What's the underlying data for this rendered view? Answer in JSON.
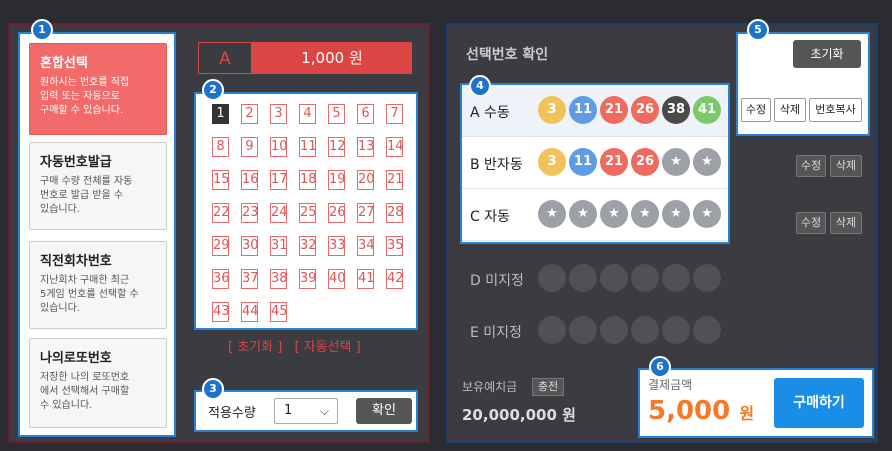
{
  "badges": [
    "1",
    "2",
    "3",
    "4",
    "5",
    "6"
  ],
  "methods": [
    {
      "title": "혼합선택",
      "desc": "원하시는 번호를 직접\n입력 또는 자동으로\n구매할 수 있습니다."
    },
    {
      "title": "자동번호발급",
      "desc": "구매 수량 전체를 자동\n번호로 발급 받을 수\n있습니다."
    },
    {
      "title": "직전회차번호",
      "desc": "지난회차 구매한 최근\n5게임 번호를 선택할 수\n있습니다."
    },
    {
      "title": "나의로또번호",
      "desc": "저장한 나의 로또번호\n에서 선택해서 구매할\n수 있습니다."
    }
  ],
  "slip": {
    "label": "A",
    "price": "1,000 원"
  },
  "grid": {
    "numbers": [
      1,
      2,
      3,
      4,
      5,
      6,
      7,
      8,
      9,
      10,
      11,
      12,
      13,
      14,
      15,
      16,
      17,
      18,
      19,
      20,
      21,
      22,
      23,
      24,
      25,
      26,
      27,
      28,
      29,
      30,
      31,
      32,
      33,
      34,
      35,
      36,
      37,
      38,
      39,
      40,
      41,
      42,
      43,
      44,
      45
    ],
    "selected": [
      1
    ]
  },
  "grid_actions": {
    "reset": "[ 초기화 ]",
    "auto": "[ 자동선택 ]"
  },
  "quantity": {
    "label": "적용수량",
    "value": "1",
    "confirm": "확인"
  },
  "right": {
    "title": "선택번호 확인",
    "deposit_label": "보유예치금",
    "deposit_button": "충전",
    "deposit_amount": "20,000,000 원",
    "rows": [
      {
        "label": "A 수동",
        "balls": [
          "3",
          "11",
          "21",
          "26",
          "38",
          "41"
        ]
      },
      {
        "label": "B 반자동",
        "balls": [
          "3",
          "11",
          "21",
          "26",
          "★",
          "★"
        ]
      },
      {
        "label": "C 자동",
        "balls": [
          "★",
          "★",
          "★",
          "★",
          "★",
          "★"
        ]
      },
      {
        "label": "D 미지정"
      },
      {
        "label": "E 미지정"
      }
    ],
    "row_buttons": {
      "edit": "수정",
      "delete": "삭제",
      "copy": "번호복사"
    }
  },
  "reset_all": "초기화",
  "payment": {
    "label": "결제금액",
    "amount": "5,000",
    "unit": "원",
    "buy": "구매하기"
  },
  "colors": {
    "yellow": "#f2c25a",
    "blue": "#5e9de6",
    "red": "#f06a5e",
    "dark": "#4a4a4a",
    "green": "#7cc96a",
    "grey": "#9da1a7"
  }
}
